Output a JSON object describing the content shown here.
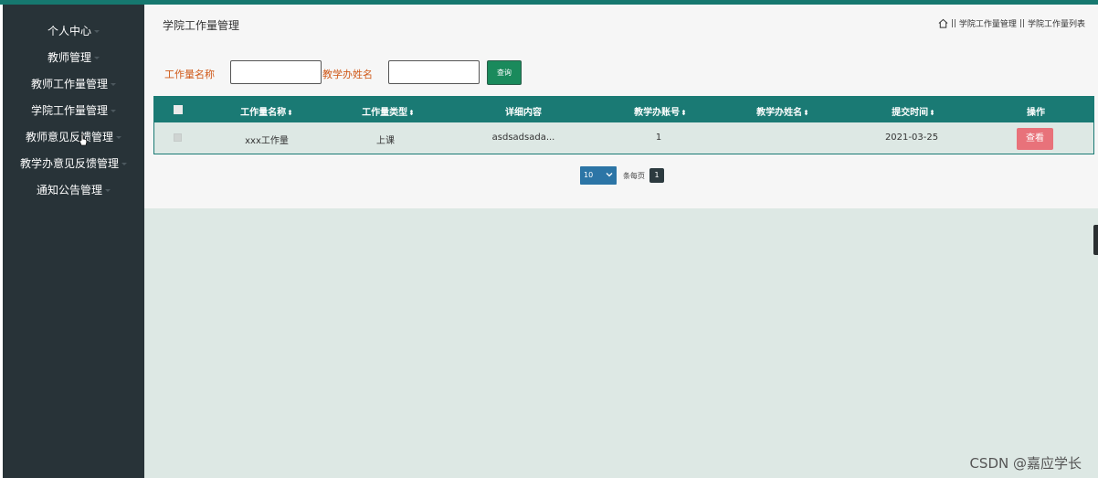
{
  "sidebar": {
    "items": [
      {
        "label": "个人中心"
      },
      {
        "label": "教师管理"
      },
      {
        "label": "教师工作量管理"
      },
      {
        "label": "学院工作量管理"
      },
      {
        "label": "教师意见反馈管理"
      },
      {
        "label": "教学办意见反馈管理"
      },
      {
        "label": "通知公告管理"
      }
    ]
  },
  "header": {
    "title": "学院工作量管理",
    "breadcrumb": {
      "sep1": "||",
      "item1": "学院工作量管理",
      "sep2": "||",
      "item2": "学院工作量列表"
    }
  },
  "search": {
    "field1_label": "工作量名称",
    "field1_value": "",
    "field2_label": "教学办姓名",
    "field2_value": "",
    "button_label": "查询"
  },
  "table": {
    "columns": [
      "工作量名称",
      "工作量类型",
      "详细内容",
      "教学办账号",
      "教学办姓名",
      "提交时间",
      "操作"
    ],
    "sort_glyph": "⬍",
    "rows": [
      {
        "name": "xxx工作量",
        "type": "上课",
        "detail": "asdsadsada...",
        "account": "1",
        "teacher_name": "",
        "time": "2021-03-25",
        "action": "查看"
      }
    ]
  },
  "pagination": {
    "page_size": "10",
    "per_page_label": "条每页",
    "current_page": "1"
  },
  "watermark": "CSDN @嘉应学长",
  "colors": {
    "accent": "#1a7a74",
    "sidebar": "#283338",
    "view_button": "#e8727a",
    "label": "#d05a1a"
  }
}
